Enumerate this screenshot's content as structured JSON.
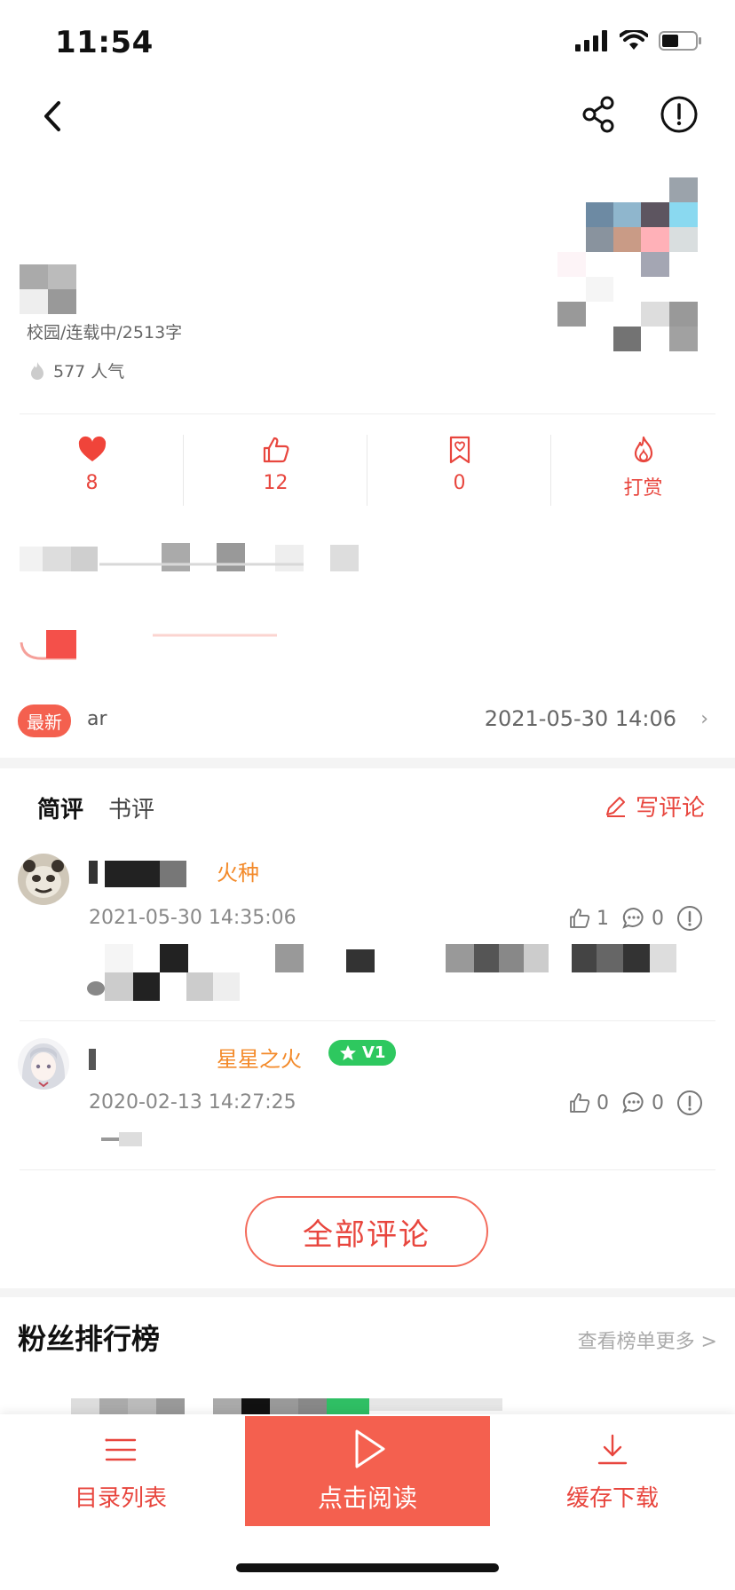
{
  "status_bar": {
    "time": "11:54"
  },
  "book": {
    "meta": "校园/连载中/2513字",
    "popularity": "577 人气"
  },
  "stats": [
    {
      "icon": "heart-icon",
      "value": "8"
    },
    {
      "icon": "thumbs-up-icon",
      "value": "12"
    },
    {
      "icon": "bookmark-heart-icon",
      "value": "0"
    },
    {
      "icon": "flame-icon",
      "value": "打赏"
    }
  ],
  "latest": {
    "badge": "最新",
    "title": "ar",
    "time": "2021-05-30 14:06",
    "arrow": "›"
  },
  "comments_section": {
    "tab_short": "简评",
    "tab_book": "书评",
    "write_label": "写评论",
    "items": [
      {
        "badge": "火种",
        "time": "2021-05-30 14:35:06",
        "likes": "1",
        "replies": "0"
      },
      {
        "badge": "星星之火",
        "level": "V1",
        "time": "2020-02-13 14:27:25",
        "likes": "0",
        "replies": "0"
      }
    ],
    "all_label": "全部评论"
  },
  "fan_rank": {
    "title": "粉丝排行榜",
    "more": "查看榜单更多 >"
  },
  "bottom_bar": {
    "catalog_label": "目录列表",
    "read_label": "点击阅读",
    "download_label": "缓存下载"
  },
  "colors": {
    "accent": "#e8463e",
    "badge_orange": "#f38a2a",
    "level_green": "#2ec85f"
  }
}
